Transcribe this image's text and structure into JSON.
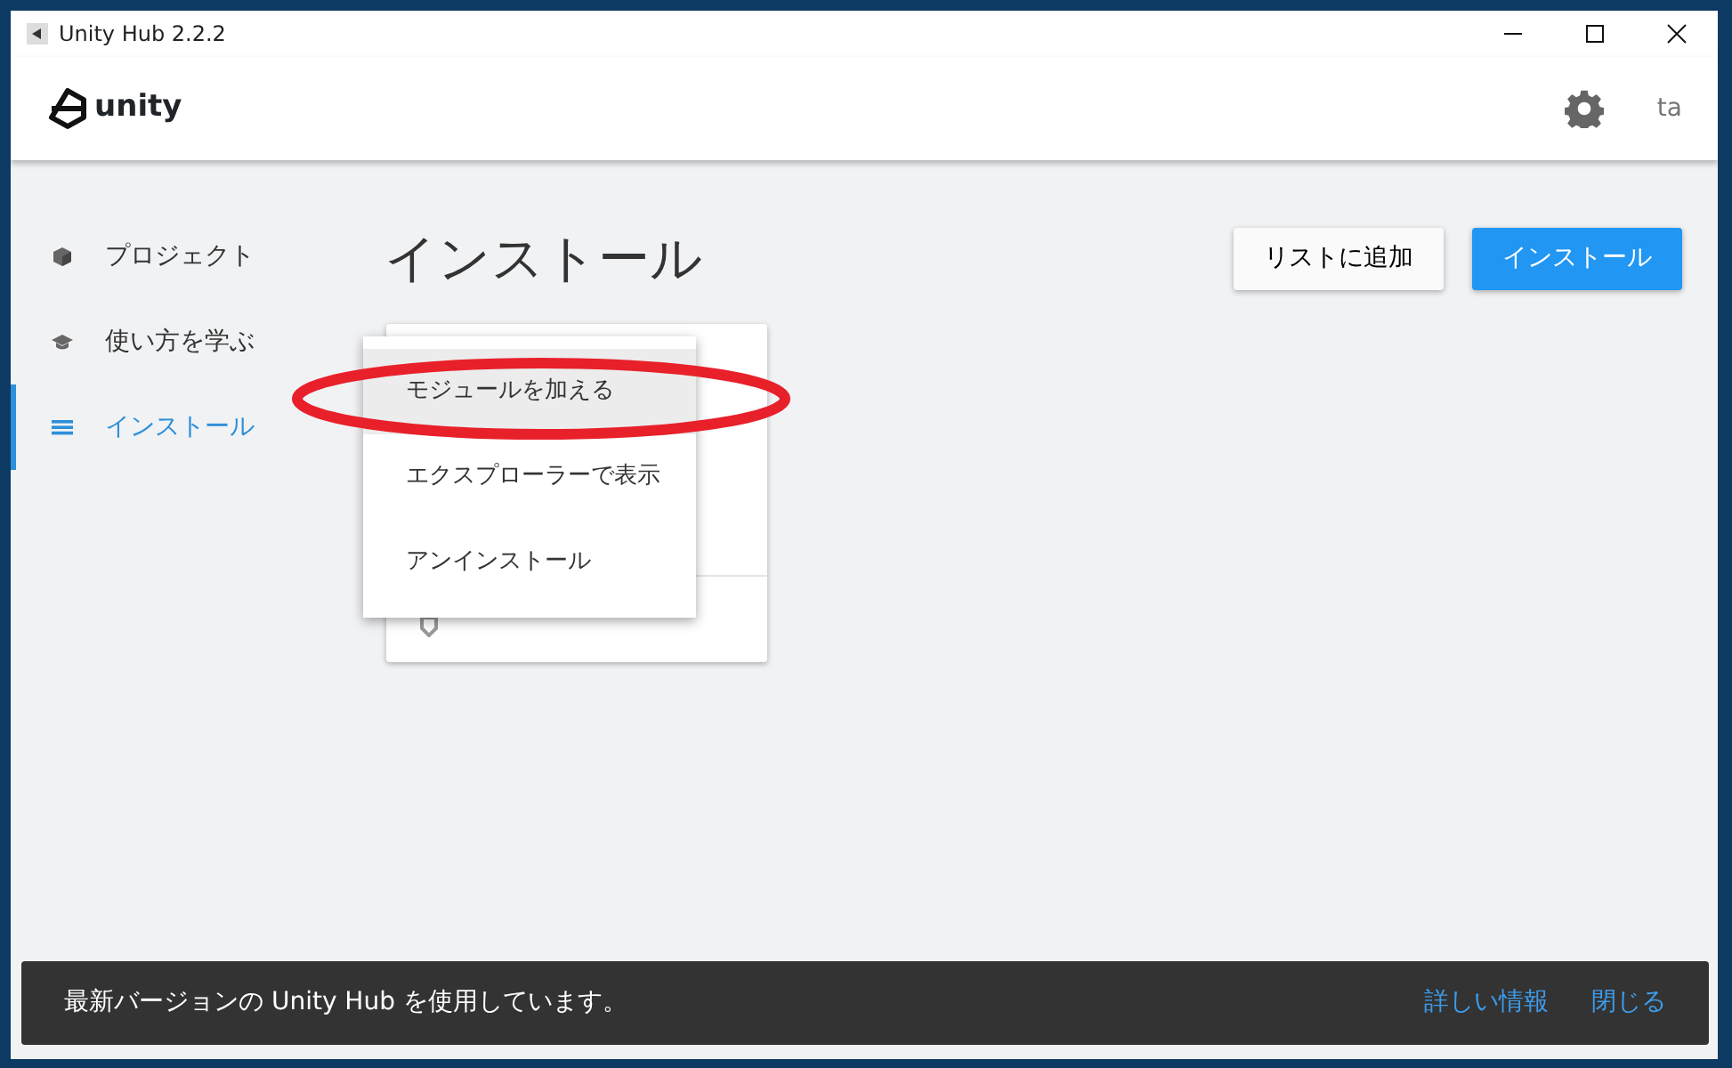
{
  "window": {
    "title": "Unity Hub 2.2.2"
  },
  "header": {
    "logo_text": "unity",
    "user": "ta"
  },
  "sidebar": {
    "items": [
      {
        "label": "プロジェクト",
        "kind": "project",
        "selected": false
      },
      {
        "label": "使い方を学ぶ",
        "kind": "learn",
        "selected": false
      },
      {
        "label": "インストール",
        "kind": "installs",
        "selected": true
      }
    ]
  },
  "page": {
    "title": "インストール"
  },
  "buttons": [
    {
      "label": "リストに追加",
      "kind": "secondary"
    },
    {
      "label": "インストール",
      "kind": "primary"
    }
  ],
  "context_menu": {
    "items": [
      {
        "label": "モジュールを加える",
        "selected": true
      },
      {
        "label": "エクスプローラーで表示",
        "selected": false
      },
      {
        "label": "アンインストール",
        "selected": false
      }
    ]
  },
  "snackbar": {
    "message": "最新バージョンの Unity Hub を使用しています。",
    "links": [
      "詳しい情報",
      "閉じる"
    ]
  }
}
